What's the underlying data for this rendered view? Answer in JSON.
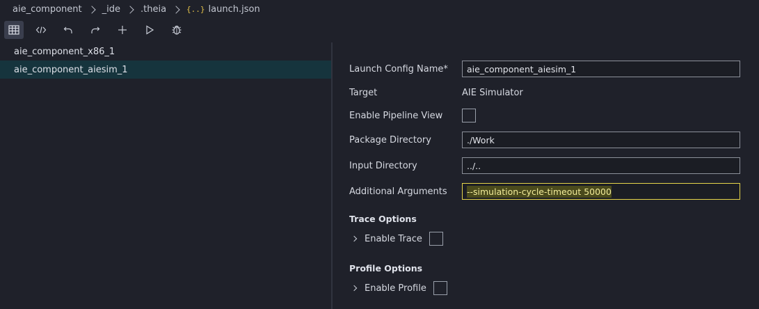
{
  "breadcrumb": {
    "items": [
      "aie_component",
      "_ide",
      ".theia",
      "launch.json"
    ],
    "file_icon": "{..}"
  },
  "toolbar": {
    "buttons": [
      {
        "icon": "table-icon",
        "active": true
      },
      {
        "icon": "code-icon",
        "active": false
      },
      {
        "icon": "undo-icon",
        "active": false
      },
      {
        "icon": "redo-icon",
        "active": false
      },
      {
        "icon": "plus-icon",
        "active": false
      },
      {
        "icon": "run-icon",
        "active": false
      },
      {
        "icon": "debug-icon",
        "active": false
      }
    ]
  },
  "configs": {
    "items": [
      {
        "label": "aie_component_x86_1",
        "selected": false
      },
      {
        "label": "aie_component_aiesim_1",
        "selected": true
      }
    ]
  },
  "form": {
    "launch_config_name": {
      "label": "Launch Config Name*",
      "value": "aie_component_aiesim_1"
    },
    "target": {
      "label": "Target",
      "value": "AIE Simulator"
    },
    "pipeline_view": {
      "label": "Enable Pipeline View",
      "checked": false
    },
    "package_directory": {
      "label": "Package Directory",
      "value": "./Work"
    },
    "input_directory": {
      "label": "Input Directory",
      "value": "../.."
    },
    "additional_arguments": {
      "label": "Additional Arguments",
      "value": "--simulation-cycle-timeout 50000"
    },
    "trace_options": {
      "title": "Trace Options",
      "enable_label": "Enable Trace",
      "checked": false
    },
    "profile_options": {
      "title": "Profile Options",
      "enable_label": "Enable Profile",
      "checked": false
    }
  },
  "colors": {
    "background": "#1f212a",
    "selected_row": "#16343d",
    "focus_border": "#e6d54a",
    "json_icon": "#e2c04a"
  }
}
